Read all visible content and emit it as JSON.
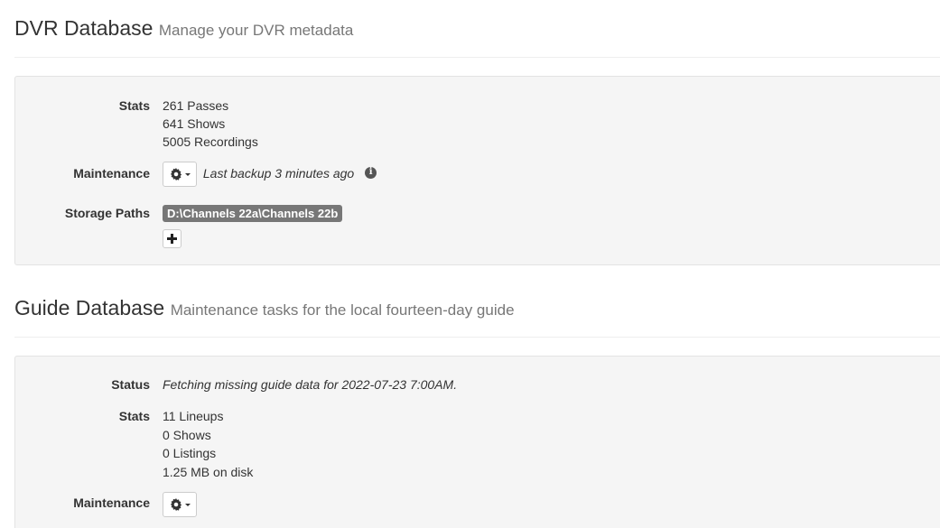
{
  "dvr": {
    "title": "DVR Database",
    "subtitle": "Manage your DVR metadata",
    "stats_label": "Stats",
    "stats": [
      "261 Passes",
      "641 Shows",
      "5005 Recordings"
    ],
    "maintenance_label": "Maintenance",
    "last_backup": "Last backup 3 minutes ago",
    "storage_label": "Storage Paths",
    "storage_path": "D:\\Channels 22a\\Channels 22b"
  },
  "guide": {
    "title": "Guide Database",
    "subtitle": "Maintenance tasks for the local fourteen-day guide",
    "status_label": "Status",
    "status": "Fetching missing guide data for 2022-07-23 7:00AM.",
    "stats_label": "Stats",
    "stats": [
      "11 Lineups",
      "0 Shows",
      "0 Listings",
      "1.25 MB on disk"
    ],
    "maintenance_label": "Maintenance"
  },
  "icons": {
    "gear": "gear-icon",
    "caret": "caret-down-icon",
    "info": "info-circle-icon",
    "plus": "plus-icon"
  }
}
